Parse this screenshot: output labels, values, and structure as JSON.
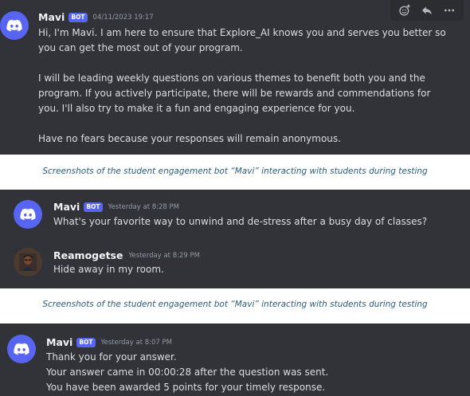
{
  "panel1": {
    "author": "Mavi",
    "badge": "BOT",
    "timestamp": "04/11/2023 19:17",
    "paragraphs": [
      [
        "Hi, I'm Mavi. I am here to ensure that Explore_AI knows you and serves you better so",
        "you can get the most out of your program."
      ],
      [
        "I will be leading weekly questions on various themes to benefit both you and the",
        "program. If you actively participate, there will be rewards and commendations for",
        "you. I'll also try to make it a fun and engaging experience for you."
      ],
      [
        "Have no fears because your responses will remain anonymous."
      ]
    ],
    "toolbar_icons": [
      "add-reaction-icon",
      "reply-icon",
      "more-options-icon"
    ]
  },
  "caption1": "Screenshots of the student engagement bot “Mavi” interacting with students during testing",
  "panel2": {
    "messages": [
      {
        "author": "Mavi",
        "badge": "BOT",
        "timestamp": "Yesterday at 8:28 PM",
        "text": "What's your favorite way to unwind and de-stress after a busy day of classes?"
      },
      {
        "author": "Reamogetse",
        "timestamp": "Yesterday at 8:29 PM",
        "text": "Hide away in my room."
      }
    ]
  },
  "caption2": "Screenshots of the student engagement bot “Mavi” interacting with students during testing",
  "panel3": {
    "author": "Mavi",
    "badge": "BOT",
    "timestamp": "Yesterday at 8:07 PM",
    "lines": [
      "Thank you for your answer.",
      "Your answer came in 00:00:28 after the question was sent.",
      "You have been awarded 5 points for your timely response."
    ]
  },
  "colors": {
    "background": "#313338",
    "accent": "#5865f2",
    "caption": "#2b5c7a"
  }
}
